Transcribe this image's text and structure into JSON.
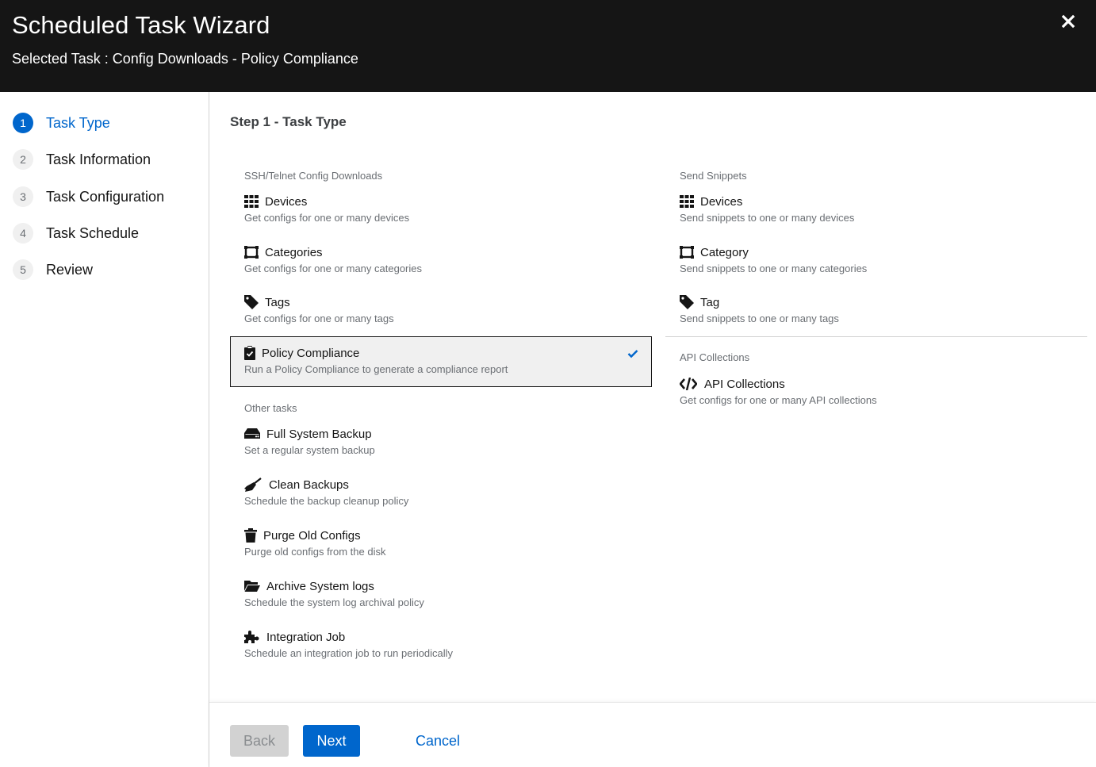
{
  "header": {
    "title": "Scheduled Task Wizard",
    "subtitle": "Selected Task : Config Downloads - Policy Compliance",
    "close_icon": "close-icon"
  },
  "nav": {
    "steps": [
      {
        "num": "1",
        "label": "Task Type",
        "active": true
      },
      {
        "num": "2",
        "label": "Task Information",
        "active": false
      },
      {
        "num": "3",
        "label": "Task Configuration",
        "active": false
      },
      {
        "num": "4",
        "label": "Task Schedule",
        "active": false
      },
      {
        "num": "5",
        "label": "Review",
        "active": false
      }
    ]
  },
  "main": {
    "step_title": "Step 1 - Task Type",
    "ssh": {
      "label": "SSH/Telnet Config Downloads",
      "options": [
        {
          "icon": "grid-icon",
          "title": "Devices",
          "desc": "Get configs for one or many devices"
        },
        {
          "icon": "categories-icon",
          "title": "Categories",
          "desc": "Get configs for one or many categories"
        },
        {
          "icon": "tag-icon",
          "title": "Tags",
          "desc": "Get configs for one or many tags"
        },
        {
          "icon": "clipboard-check-icon",
          "title": "Policy Compliance",
          "desc": "Run a Policy Compliance to generate a compliance report",
          "selected": true
        }
      ]
    },
    "other": {
      "label": "Other tasks",
      "options": [
        {
          "icon": "hdd-icon",
          "title": "Full System Backup",
          "desc": "Set a regular system backup"
        },
        {
          "icon": "broom-icon",
          "title": "Clean Backups",
          "desc": "Schedule the backup cleanup policy"
        },
        {
          "icon": "trash-icon",
          "title": "Purge Old Configs",
          "desc": "Purge old configs from the disk"
        },
        {
          "icon": "folder-open-icon",
          "title": "Archive System logs",
          "desc": "Schedule the system log archival policy"
        },
        {
          "icon": "puzzle-icon",
          "title": "Integration Job",
          "desc": "Schedule an integration job to run periodically"
        }
      ]
    },
    "snippets": {
      "label": "Send Snippets",
      "options": [
        {
          "icon": "grid-icon",
          "title": "Devices",
          "desc": "Send snippets to one or many devices"
        },
        {
          "icon": "categories-icon",
          "title": "Category",
          "desc": "Send snippets to one or many categories"
        },
        {
          "icon": "tag-icon",
          "title": "Tag",
          "desc": "Send snippets to one or many tags"
        }
      ]
    },
    "api": {
      "label": "API Collections",
      "options": [
        {
          "icon": "code-icon",
          "title": "API Collections",
          "desc": "Get configs for one or many API collections"
        }
      ]
    }
  },
  "footer": {
    "back_label": "Back",
    "next_label": "Next",
    "cancel_label": "Cancel"
  },
  "colors": {
    "header_bg": "#151515",
    "accent": "#0066cc",
    "muted_text": "#6a6e73",
    "selected_bg": "#f0f0f0"
  }
}
